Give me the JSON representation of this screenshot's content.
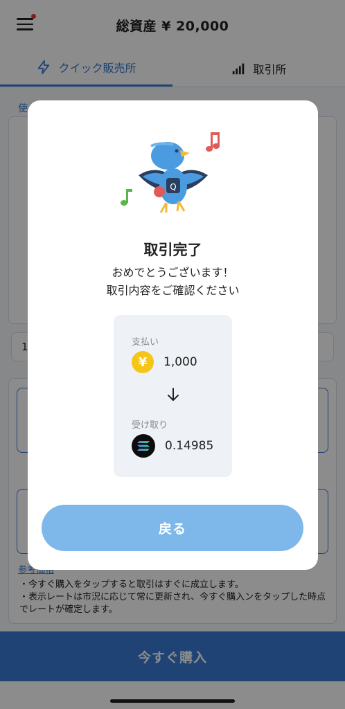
{
  "header": {
    "title": "総資産 ¥ 20,000",
    "icon": "hamburger-menu-icon"
  },
  "tabs": [
    {
      "label": "クイック販売所",
      "icon": "lightning-icon",
      "active": true
    },
    {
      "label": "取引所",
      "icon": "signal-bars-icon",
      "active": false
    }
  ],
  "background": {
    "section_label": "使",
    "input_value": "1",
    "reference_link": "参考価格",
    "notes": [
      "・今すぐ購入をタップすると取引はすぐに成立します。",
      "・表示レートは市況に応じて常に更新され、今すぐ購入ンをタップした時点でレートが確定します。"
    ],
    "buy_button": "今すぐ購入"
  },
  "modal": {
    "title": "取引完了",
    "message_line1": "おめでとうございます！",
    "message_line2": "取引内容をご確認ください",
    "payment_label": "支払い",
    "payment_currency_symbol": "¥",
    "payment_amount": "1,000",
    "receive_label": "受け取り",
    "receive_amount": "0.14985",
    "receive_icon": "solana-icon",
    "back_button": "戻る"
  },
  "colors": {
    "accent": "#3a7bd5",
    "back_button": "#7eb8ea",
    "yen_coin": "#f5c518",
    "summary_bg": "#eef2f7"
  }
}
